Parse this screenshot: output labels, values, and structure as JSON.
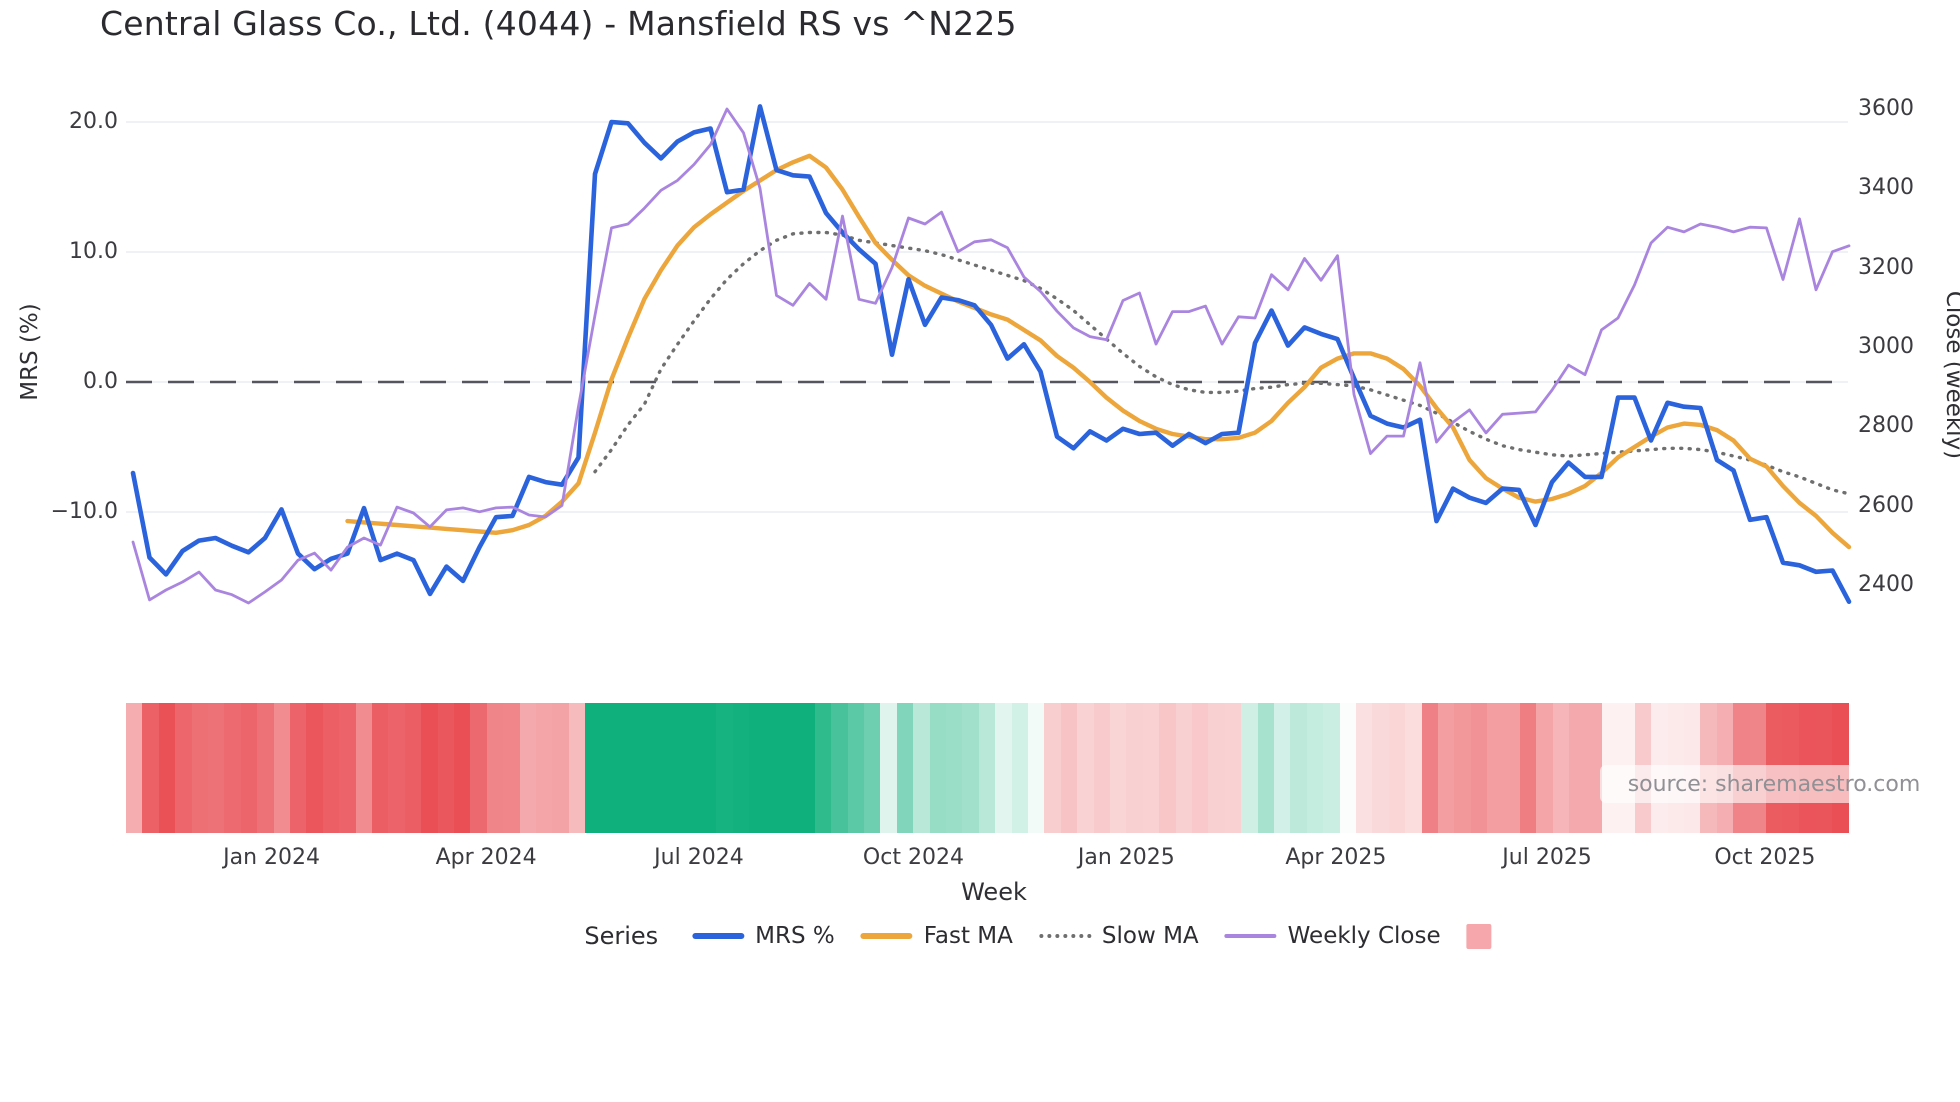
{
  "title": "Central Glass Co., Ltd. (4044) - Mansfield RS vs ^N225",
  "watermark": "source: sharemaestro.com",
  "legend": {
    "title": "Series",
    "items": [
      {
        "label": "MRS %",
        "swatch": "line",
        "color": "#2a63dc"
      },
      {
        "label": "Fast MA",
        "swatch": "line",
        "color": "#eca63b"
      },
      {
        "label": "Slow MA",
        "swatch": "dotted",
        "color": "#6f6f6f"
      },
      {
        "label": "Weekly Close",
        "swatch": "thin-line",
        "color": "#aa85df"
      },
      {
        "label": "",
        "swatch": "square",
        "color": "#f5a7ab"
      }
    ]
  },
  "chart_data": {
    "type": "line",
    "title": "Central Glass Co., Ltd. (4044) - Mansfield RS vs ^N225",
    "x_axis": {
      "label": "Week",
      "unit": "weekly index, ~Nov 2023 to ~Nov 2025",
      "ticks": [
        {
          "label": "Jan 2024",
          "week": 8.4
        },
        {
          "label": "Apr 2024",
          "week": 21.4
        },
        {
          "label": "Jul 2024",
          "week": 34.3
        },
        {
          "label": "Oct 2024",
          "week": 47.3
        },
        {
          "label": "Jan 2025",
          "week": 60.2
        },
        {
          "label": "Apr 2025",
          "week": 72.9
        },
        {
          "label": "Jul 2025",
          "week": 85.7
        },
        {
          "label": "Oct 2025",
          "week": 98.9
        }
      ]
    },
    "left_axis": {
      "label": "MRS (%)",
      "tick_values": [
        20,
        10,
        0,
        -10
      ],
      "tick_labels": [
        "20.0",
        "10.0",
        "0.0",
        "−10.0"
      ],
      "range": [
        -18.5,
        22.5
      ],
      "zero_line": true
    },
    "right_axis": {
      "label": "Close (weekly)",
      "tick_values": [
        3600,
        3400,
        3200,
        3000,
        2800,
        2600,
        2400
      ],
      "tick_labels": [
        "3600",
        "3400",
        "3200",
        "3000",
        "2800",
        "2600",
        "2400"
      ],
      "range": [
        2290,
        3630
      ]
    },
    "grid": "horizontal-light",
    "legend_position": "bottom",
    "series": [
      {
        "name": "MRS %",
        "axis": "left",
        "color": "#2a63dc",
        "width": 4.6,
        "dash": "",
        "values": [
          -7.0,
          -13.5,
          -14.8,
          -13.0,
          -12.2,
          -12.0,
          -12.6,
          -13.1,
          -12.0,
          -9.8,
          -13.2,
          -14.4,
          -13.6,
          -13.2,
          -9.7,
          -13.7,
          -13.2,
          -13.7,
          -16.3,
          -14.2,
          -15.3,
          -12.7,
          -10.4,
          -10.3,
          -7.3,
          -7.7,
          -7.9,
          -5.8,
          16.0,
          20.0,
          19.9,
          18.4,
          17.2,
          18.5,
          19.2,
          19.5,
          14.6,
          14.8,
          21.2,
          16.3,
          15.9,
          15.8,
          13.0,
          11.5,
          10.2,
          9.1,
          2.1,
          7.9,
          4.4,
          6.5,
          6.3,
          5.9,
          4.4,
          1.8,
          2.9,
          0.8,
          -4.2,
          -5.1,
          -3.8,
          -4.5,
          -3.6,
          -4.0,
          -3.9,
          -4.9,
          -4.0,
          -4.7,
          -4.0,
          -3.9,
          3.0,
          5.5,
          2.8,
          4.2,
          3.7,
          3.3,
          0.3,
          -2.6,
          -3.2,
          -3.5,
          -2.9,
          -10.7,
          -8.2,
          -8.9,
          -9.3,
          -8.2,
          -8.3,
          -11.0,
          -7.7,
          -6.2,
          -7.3,
          -7.3,
          -1.2,
          -1.2,
          -4.5,
          -1.6,
          -1.9,
          -2.0,
          -6.0,
          -6.8,
          -10.6,
          -10.4,
          -13.9,
          -14.1,
          -14.6,
          -14.5,
          -16.9
        ]
      },
      {
        "name": "Fast MA",
        "axis": "left",
        "color": "#eca63b",
        "width": 4.4,
        "dash": "",
        "values": [
          null,
          null,
          null,
          null,
          null,
          null,
          null,
          null,
          null,
          null,
          null,
          null,
          null,
          -10.7,
          -10.8,
          -10.9,
          -11.0,
          -11.1,
          -11.2,
          -11.3,
          -11.4,
          -11.5,
          -11.6,
          -11.4,
          -11.0,
          -10.3,
          -9.2,
          -7.8,
          -3.9,
          0.2,
          3.4,
          6.4,
          8.6,
          10.5,
          11.9,
          12.9,
          13.8,
          14.7,
          15.5,
          16.3,
          16.9,
          17.4,
          16.5,
          14.8,
          12.7,
          10.7,
          9.4,
          8.2,
          7.4,
          6.8,
          6.2,
          5.7,
          5.2,
          4.8,
          4.0,
          3.2,
          2.0,
          1.1,
          0.0,
          -1.2,
          -2.2,
          -3.0,
          -3.6,
          -4.0,
          -4.2,
          -4.4,
          -4.4,
          -4.3,
          -3.9,
          -3.0,
          -1.6,
          -0.4,
          1.1,
          1.8,
          2.2,
          2.2,
          1.8,
          1.0,
          -0.3,
          -2.0,
          -3.5,
          -6.0,
          -7.4,
          -8.2,
          -8.9,
          -9.2,
          -9.0,
          -8.6,
          -8.0,
          -7.0,
          -5.8,
          -5.0,
          -4.2,
          -3.5,
          -3.2,
          -3.3,
          -3.7,
          -4.5,
          -5.9,
          -6.5,
          -8.0,
          -9.3,
          -10.3,
          -11.6,
          -12.7
        ]
      },
      {
        "name": "Slow MA",
        "axis": "left",
        "color": "#6f6f6f",
        "width": 3.4,
        "dash": "1 7.5",
        "values": [
          null,
          null,
          null,
          null,
          null,
          null,
          null,
          null,
          null,
          null,
          null,
          null,
          null,
          null,
          null,
          null,
          null,
          null,
          null,
          null,
          null,
          null,
          null,
          null,
          null,
          null,
          null,
          null,
          -6.9,
          -5.2,
          -3.3,
          -1.7,
          1.0,
          2.9,
          4.7,
          6.4,
          7.9,
          9.1,
          10.1,
          10.9,
          11.4,
          11.5,
          11.5,
          11.3,
          10.9,
          10.7,
          10.5,
          10.3,
          10.1,
          9.8,
          9.4,
          9.0,
          8.6,
          8.2,
          7.8,
          7.2,
          6.4,
          5.5,
          4.4,
          3.3,
          2.2,
          1.2,
          0.4,
          -0.2,
          -0.6,
          -0.8,
          -0.8,
          -0.7,
          -0.5,
          -0.4,
          -0.2,
          -0.1,
          -0.1,
          -0.2,
          -0.3,
          -0.6,
          -1.0,
          -1.4,
          -1.8,
          -2.4,
          -3.1,
          -3.8,
          -4.4,
          -4.9,
          -5.2,
          -5.4,
          -5.6,
          -5.7,
          -5.6,
          -5.5,
          -5.4,
          -5.3,
          -5.2,
          -5.1,
          -5.1,
          -5.2,
          -5.4,
          -5.7,
          -6.0,
          -6.4,
          -6.9,
          -7.3,
          -7.8,
          -8.3,
          -8.6
        ]
      },
      {
        "name": "Weekly Close",
        "axis": "right",
        "color": "#aa85df",
        "width": 2.8,
        "dash": "",
        "values": [
          2508,
          2362,
          2387,
          2407,
          2432,
          2387,
          2375,
          2354,
          2382,
          2412,
          2462,
          2480,
          2437,
          2495,
          2518,
          2500,
          2596,
          2581,
          2546,
          2589,
          2594,
          2584,
          2594,
          2596,
          2576,
          2571,
          2600,
          2850,
          3080,
          3300,
          3310,
          3350,
          3395,
          3420,
          3460,
          3510,
          3600,
          3540,
          3400,
          3130,
          3105,
          3160,
          3120,
          3330,
          3120,
          3110,
          3200,
          3325,
          3310,
          3340,
          3240,
          3265,
          3270,
          3250,
          3176,
          3140,
          3090,
          3048,
          3026,
          3018,
          3117,
          3136,
          3007,
          3089,
          3089,
          3103,
          3007,
          3076,
          3073,
          3182,
          3144,
          3223,
          3168,
          3230,
          2880,
          2731,
          2775,
          2775,
          2960,
          2760,
          2810,
          2841,
          2783,
          2830,
          2833,
          2836,
          2891,
          2954,
          2930,
          3043,
          3073,
          3156,
          3262,
          3302,
          3290,
          3310,
          3302,
          3290,
          3302,
          3300,
          3170,
          3323,
          3144,
          3240,
          3255
        ]
      }
    ],
    "heatmap": {
      "colors_from": "MRS %",
      "positive_color": "#10b07c",
      "negative_color": "#e94f55",
      "max_abs": 15,
      "legend_swatch": "#f5a7ab"
    },
    "zero_line_color": "#55555f",
    "grid_color": "#e9edf4"
  }
}
